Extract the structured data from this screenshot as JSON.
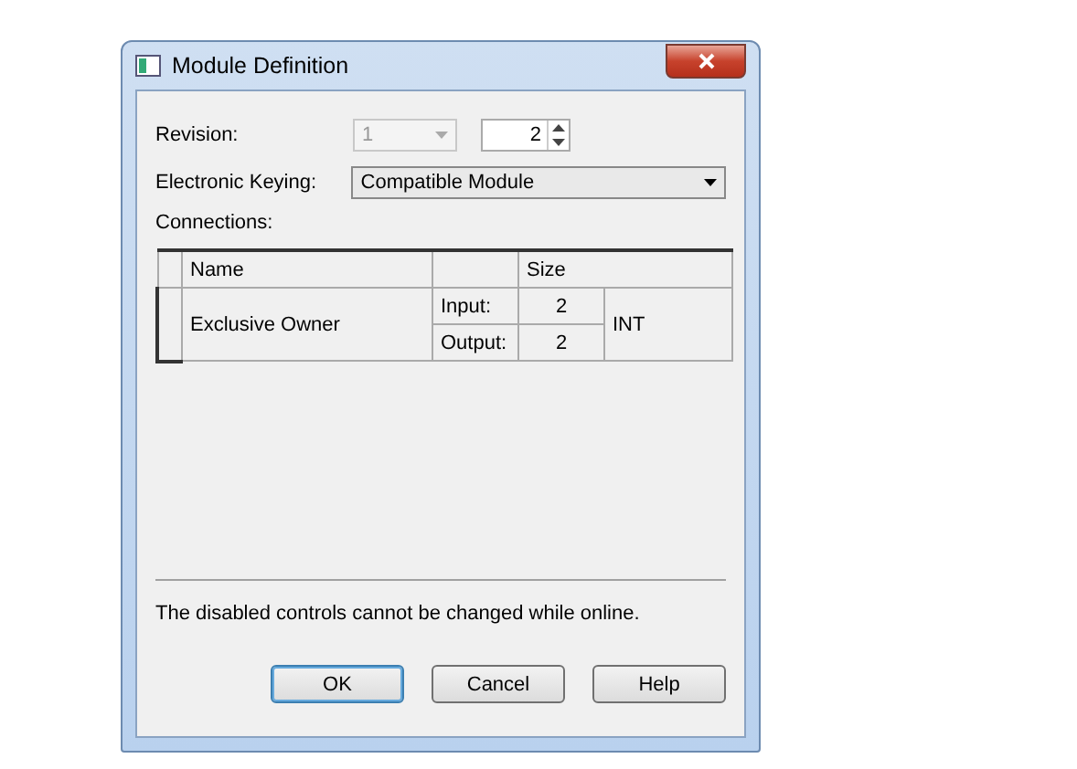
{
  "window": {
    "title": "Module Definition"
  },
  "revision": {
    "label": "Revision:",
    "major": {
      "value": "1",
      "disabled": true
    },
    "minor": {
      "value": "2"
    }
  },
  "keying": {
    "label": "Electronic Keying:",
    "value": "Compatible Module"
  },
  "connections": {
    "label": "Connections:",
    "columns": [
      "Name",
      "",
      "Size"
    ],
    "rows": [
      {
        "name": "Exclusive Owner",
        "input_label": "Input:",
        "input_size": "2",
        "output_label": "Output:",
        "output_size": "2",
        "type": "INT"
      }
    ]
  },
  "note": "The disabled controls cannot be changed while online.",
  "buttons": [
    {
      "label": "OK",
      "default": true
    },
    {
      "label": "Cancel",
      "default": false
    },
    {
      "label": "Help",
      "default": false
    }
  ]
}
